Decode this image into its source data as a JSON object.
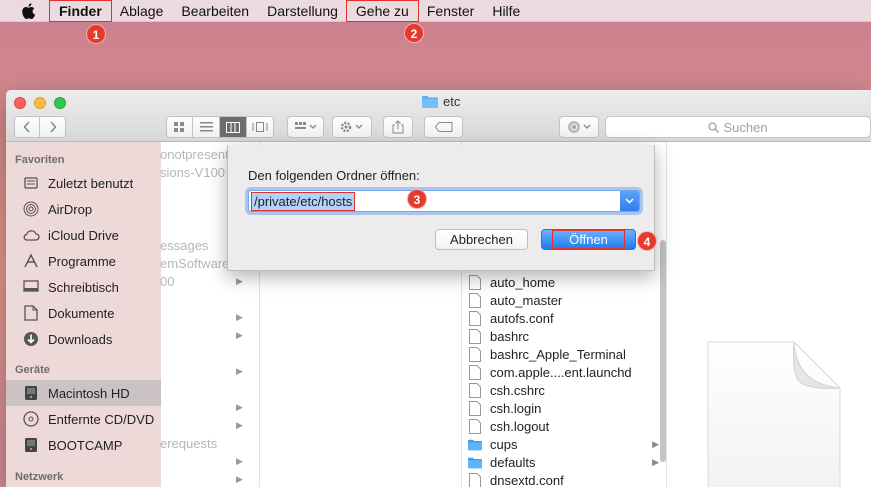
{
  "menubar": {
    "items": [
      {
        "label": "Finder"
      },
      {
        "label": "Ablage"
      },
      {
        "label": "Bearbeiten"
      },
      {
        "label": "Darstellung"
      },
      {
        "label": "Gehe zu"
      },
      {
        "label": "Fenster"
      },
      {
        "label": "Hilfe"
      }
    ]
  },
  "badges": [
    "1",
    "2",
    "3",
    "4"
  ],
  "window": {
    "title": "etc",
    "search_placeholder": "Suchen"
  },
  "sidebar": {
    "favorites_header": "Favoriten",
    "favorites": [
      {
        "label": "Zuletzt benutzt",
        "icon": "recents-icon"
      },
      {
        "label": "AirDrop",
        "icon": "airdrop-icon"
      },
      {
        "label": "iCloud Drive",
        "icon": "cloud-icon"
      },
      {
        "label": "Programme",
        "icon": "applications-icon"
      },
      {
        "label": "Schreibtisch",
        "icon": "desktop-icon"
      },
      {
        "label": "Dokumente",
        "icon": "documents-icon"
      },
      {
        "label": "Downloads",
        "icon": "downloads-icon"
      }
    ],
    "devices_header": "Geräte",
    "devices": [
      {
        "label": "Macintosh HD",
        "icon": "harddisk-icon",
        "selected": true
      },
      {
        "label": "Entfernte CD/DVD",
        "icon": "disc-icon"
      },
      {
        "label": "BOOTCAMP",
        "icon": "drive-icon"
      }
    ],
    "network_header": "Netzwerk"
  },
  "column1": {
    "items": [
      "onotpresent",
      "sions-V100",
      "essages",
      "emSoftware",
      "00",
      "erequests"
    ]
  },
  "files": [
    {
      "name": "auto_home",
      "folder": false
    },
    {
      "name": "auto_master",
      "folder": false
    },
    {
      "name": "autofs.conf",
      "folder": false
    },
    {
      "name": "bashrc",
      "folder": false
    },
    {
      "name": "bashrc_Apple_Terminal",
      "folder": false
    },
    {
      "name": "com.apple....ent.launchd",
      "folder": false
    },
    {
      "name": "csh.cshrc",
      "folder": false
    },
    {
      "name": "csh.login",
      "folder": false
    },
    {
      "name": "csh.logout",
      "folder": false
    },
    {
      "name": "cups",
      "folder": true
    },
    {
      "name": "defaults",
      "folder": true
    },
    {
      "name": "dnsextd.conf",
      "folder": false
    }
  ],
  "dialog": {
    "label": "Den folgenden Ordner öffnen:",
    "path_value": "/private/etc/hosts",
    "cancel_label": "Abbrechen",
    "open_label": "Öffnen"
  },
  "colors": {
    "accent": "#2e7ff1",
    "annotation": "#e2312b"
  }
}
